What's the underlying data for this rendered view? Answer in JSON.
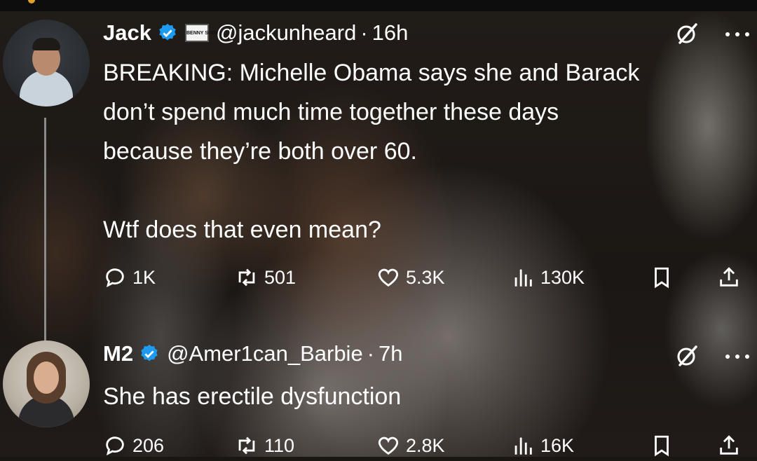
{
  "tweets": [
    {
      "name": "Jack",
      "affiliate_badge_text": "BENNY SHOW",
      "handle": "@jackunheard",
      "separator": "·",
      "time": "16h",
      "text_lines": [
        "BREAKING: Michelle Obama says she and Barack",
        "don’t spend much time together these days",
        "because they’re both over 60.",
        "Wtf does that even mean?"
      ],
      "replies": "1K",
      "reposts": "501",
      "likes": "5.3K",
      "views": "130K"
    },
    {
      "name": "M2",
      "handle": "@Amer1can_Barbie",
      "separator": "·",
      "time": "7h",
      "text_lines": [
        "She has erectile dysfunction"
      ],
      "replies": "206",
      "reposts": "110",
      "likes": "2.8K",
      "views": "16K"
    }
  ],
  "colors": {
    "verified": "#1d9bf0",
    "text": "#ffffff",
    "thread_line": "#8a8a8a"
  },
  "icons": [
    "verified-badge-icon",
    "grok-icon",
    "more-icon",
    "reply-icon",
    "repost-icon",
    "like-icon",
    "views-icon",
    "bookmark-icon",
    "share-icon"
  ]
}
